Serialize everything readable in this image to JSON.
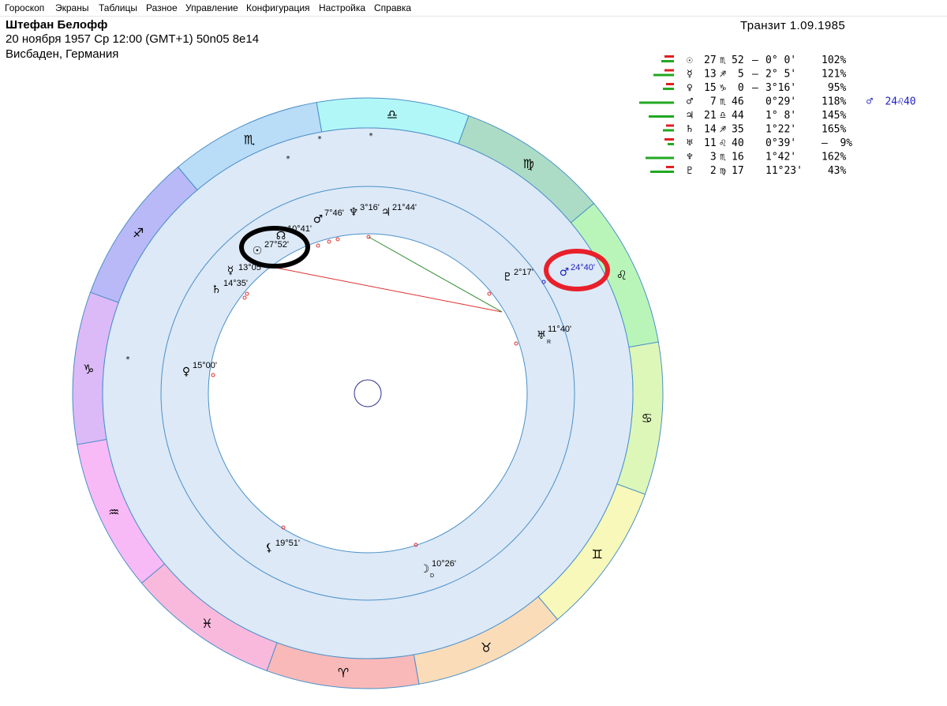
{
  "menu": [
    {
      "id": "horoscope",
      "label": "Гороскоп"
    },
    {
      "id": "screens",
      "label": "Экраны"
    },
    {
      "id": "tables",
      "label": "Таблицы"
    },
    {
      "id": "misc",
      "label": "Разное"
    },
    {
      "id": "control",
      "label": "Управление"
    },
    {
      "id": "config",
      "label": "Конфигурация"
    },
    {
      "id": "settings",
      "label": "Настройка"
    },
    {
      "id": "help",
      "label": "Справка"
    }
  ],
  "header": {
    "name": "Штефан Белофф",
    "birth": "20 ноября 1957  Ср  12:00 (GMT+1) 50n05  8e14",
    "place": "Висбаден, Германия",
    "transit": "Транзит  1.09.1985"
  },
  "colors": {
    "ring_border": "#4a90c8",
    "ring_fill": "#dde9f7",
    "inner_fill": "#ffffff",
    "transit_text": "#2020c0",
    "bar_green": "#22a822",
    "bar_red": "#e02020",
    "aspect_red": "#e03030",
    "aspect_green": "#2e8b2e",
    "highlight_black": "#000000",
    "highlight_red": "#e8202a",
    "center_circle": "#303090"
  },
  "zodiac": [
    {
      "name": "libra",
      "glyph": "♎",
      "fill": "#b2f7f7"
    },
    {
      "name": "virgo",
      "glyph": "♍",
      "fill": "#acdcc5"
    },
    {
      "name": "leo",
      "glyph": "♌",
      "fill": "#b9f5b8"
    },
    {
      "name": "cancer",
      "glyph": "♋",
      "fill": "#ddf7b9"
    },
    {
      "name": "gemini",
      "glyph": "♊",
      "fill": "#f7f8b9"
    },
    {
      "name": "taurus",
      "glyph": "♉",
      "fill": "#fadcb9"
    },
    {
      "name": "aries",
      "glyph": "♈",
      "fill": "#f9b9b9"
    },
    {
      "name": "pisces",
      "glyph": "♓",
      "fill": "#f9b9dd"
    },
    {
      "name": "aquarius",
      "glyph": "♒",
      "fill": "#f8b9f7"
    },
    {
      "name": "capricorn",
      "glyph": "♑",
      "fill": "#dcb9f7"
    },
    {
      "name": "sagittarius",
      "glyph": "♐",
      "fill": "#b9b9f7"
    },
    {
      "name": "scorpio",
      "glyph": "♏",
      "fill": "#b9dcf7"
    }
  ],
  "natal_planets": [
    {
      "name": "sun",
      "glyph": "☉",
      "label": "27°52'"
    },
    {
      "name": "mercury",
      "glyph": "☿",
      "label": "13°05'"
    },
    {
      "name": "saturn",
      "glyph": "♄",
      "label": "14°35'"
    },
    {
      "name": "venus",
      "glyph": "♀",
      "label": "15°00'"
    },
    {
      "name": "mars",
      "glyph": "♂",
      "label": "7°46'"
    },
    {
      "name": "neptune",
      "glyph": "♆",
      "label": "3°16'"
    },
    {
      "name": "jupiter",
      "glyph": "♃",
      "label": "21°44'"
    },
    {
      "name": "pluto",
      "glyph": "♇",
      "label": "2°17'"
    },
    {
      "name": "uranus",
      "glyph": "♅",
      "label": "11°40'",
      "retro": "R"
    },
    {
      "name": "node",
      "glyph": "☊",
      "label": "10°41'"
    },
    {
      "name": "lilith",
      "glyph": "⚸",
      "label": "19°51'"
    },
    {
      "name": "moon",
      "glyph": "☽",
      "label": "10°26'",
      "retro": "D"
    }
  ],
  "transit_planet": {
    "name": "mars",
    "glyph": "♂",
    "label": "24°40'"
  },
  "table": {
    "rows": [
      {
        "glyph": "☉",
        "lon": "27",
        "sign": "♏",
        "min": "52",
        "sep": "–",
        "orb": "0° 0'",
        "pct": "102%",
        "green": 16,
        "red": 12
      },
      {
        "glyph": "☿",
        "lon": "13",
        "sign": "♐",
        "min": " 5",
        "sep": "–",
        "orb": "2° 5'",
        "pct": "121%",
        "green": 26,
        "red": 12
      },
      {
        "glyph": "♀",
        "lon": "15",
        "sign": "♑",
        "min": " 0",
        "sep": "–",
        "orb": "3°16'",
        "pct": " 95%",
        "green": 14,
        "red": 10
      },
      {
        "glyph": "♂",
        "lon": " 7",
        "sign": "♏",
        "min": "46",
        "sep": " ",
        "orb": "0°29'",
        "pct": "118%",
        "green": 44,
        "red": 0,
        "transit": "♂  24♌40"
      },
      {
        "glyph": "♃",
        "lon": "21",
        "sign": "♎",
        "min": "44",
        "sep": " ",
        "orb": "1° 8'",
        "pct": "145%",
        "green": 32,
        "red": 0
      },
      {
        "glyph": "♄",
        "lon": "14",
        "sign": "♐",
        "min": "35",
        "sep": " ",
        "orb": "1°22'",
        "pct": "165%",
        "green": 14,
        "red": 10
      },
      {
        "glyph": "♅",
        "lon": "11",
        "sign": "♌",
        "min": "40",
        "sep": " ",
        "orb": "0°39'",
        "pct": "–  9%",
        "green": 8,
        "red": 12
      },
      {
        "glyph": "♆",
        "lon": " 3",
        "sign": "♏",
        "min": "16",
        "sep": " ",
        "orb": "1°42'",
        "pct": "162%",
        "green": 36,
        "red": 0
      },
      {
        "glyph": "♇",
        "lon": " 2",
        "sign": "♍",
        "min": "17",
        "sep": "",
        "orb": "11°23'",
        "pct": " 43%",
        "green": 30,
        "red": 10
      }
    ]
  }
}
